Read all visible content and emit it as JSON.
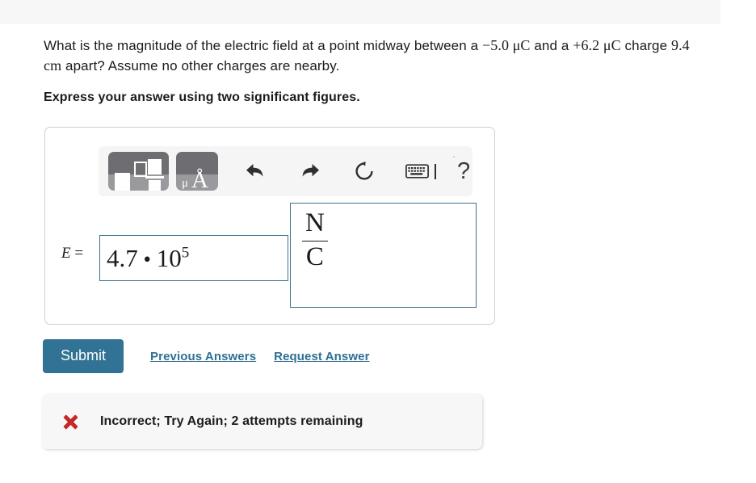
{
  "question": {
    "text_part1": "What is the magnitude of the electric field at a point midway between a ",
    "charge1": "−5.0 μC",
    "text_part2": " and a ",
    "charge2": "+6.2 μC",
    "text_part3": " charge ",
    "distance": "9.4 cm",
    "text_part4": " apart? Assume no other charges are nearby.",
    "full_text": "What is the magnitude of the electric field at a point midway between a −5.0 μC and a +6.2 μC charge 9.4 cm apart? Assume no other charges are nearby.",
    "instruction": "Express your answer using two significant figures."
  },
  "toolbar": {
    "templates_tile": "math-templates",
    "units_tile_mu": "μ",
    "units_tile_symbol": "Å",
    "undo_label": "undo",
    "redo_label": "redo",
    "reset_label": "reset",
    "keyboard_label": "keyboard",
    "help_label": "?"
  },
  "answer": {
    "variable": "E",
    "equals": "=",
    "value_mantissa": "4.7",
    "value_operator": "•",
    "value_base": "10",
    "value_exponent": "5",
    "value_full": "4.7 • 10⁵",
    "unit_numerator": "N",
    "unit_denominator": "C",
    "unit_full": "N/C",
    "value_placeholder": "",
    "unit_placeholder": ""
  },
  "actions": {
    "submit_label": "Submit",
    "previous_answers_label": "Previous Answers",
    "request_answer_label": "Request Answer"
  },
  "feedback": {
    "icon": "x-mark",
    "message": "Incorrect; Try Again; 2 attempts remaining"
  },
  "colors": {
    "submit_bg": "#327294",
    "link": "#2f6f91",
    "input_border": "#3c7391",
    "error_icon": "#c62828",
    "top_strip": "#f7f7f7",
    "panel_bg": "#f5f5f5"
  }
}
